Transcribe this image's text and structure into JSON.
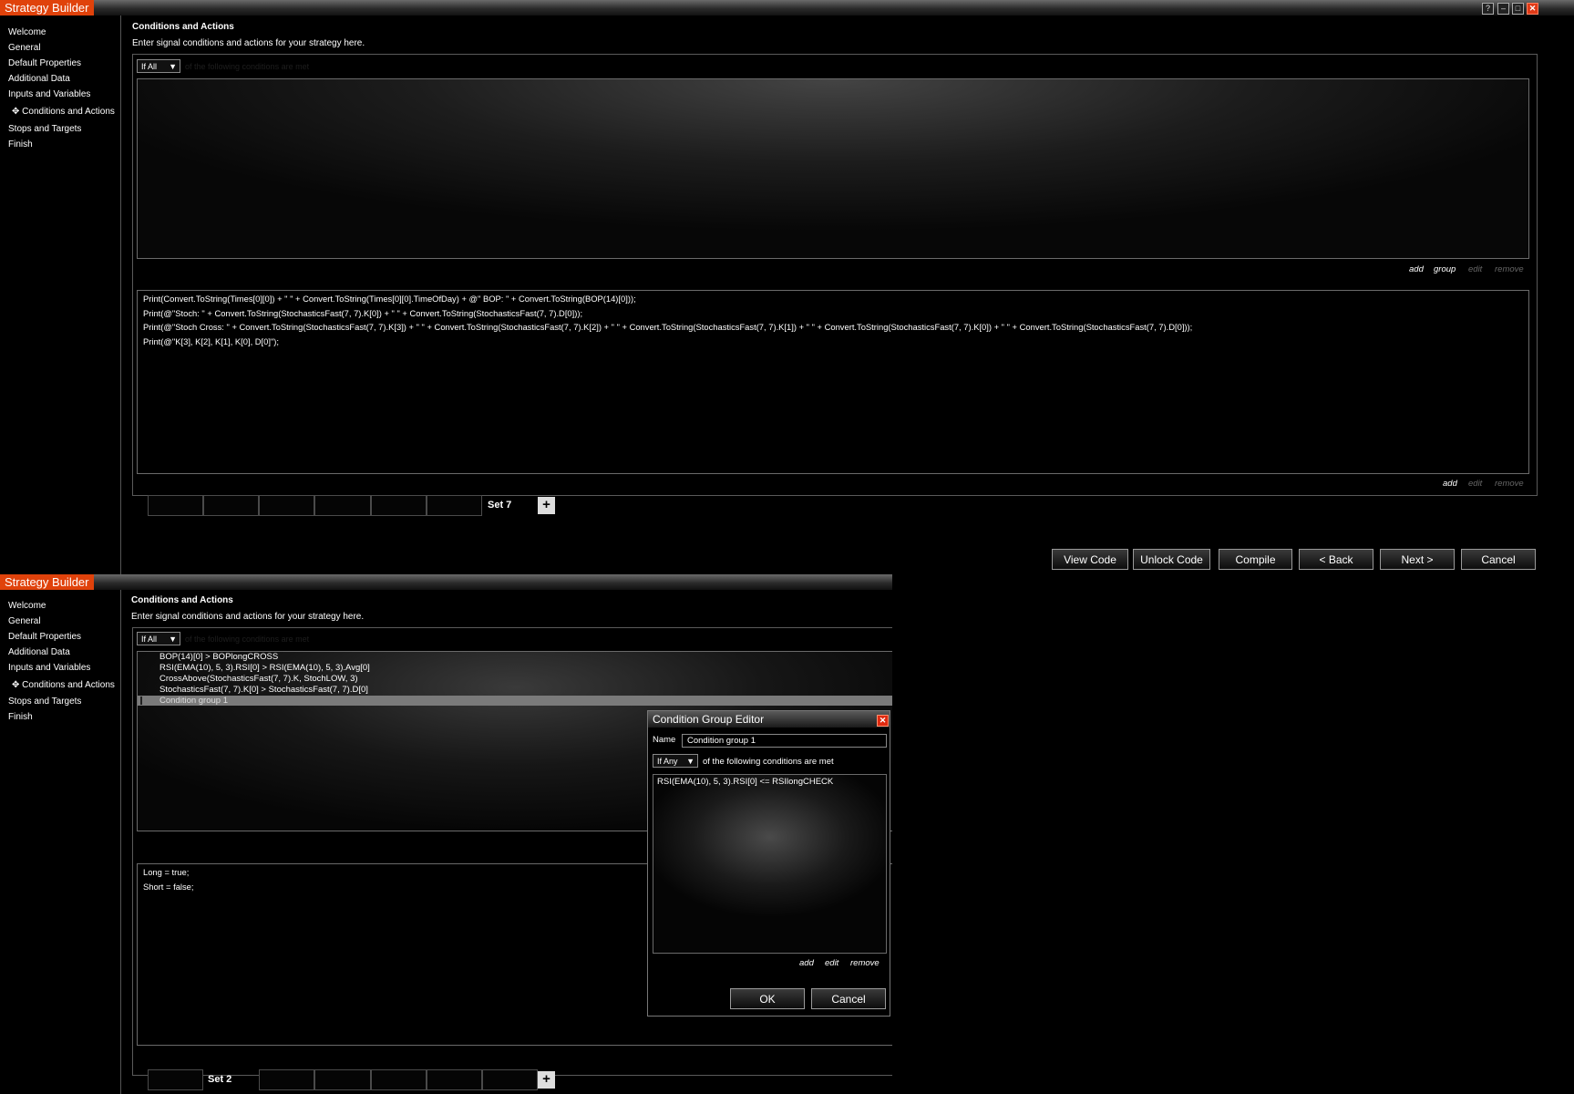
{
  "top": {
    "app_title": "Strategy Builder",
    "window_controls": [
      "?",
      "–",
      "□",
      "✕"
    ],
    "sidebar": [
      "Welcome",
      "General",
      "Default Properties",
      "Additional Data",
      "Inputs and Variables",
      "✥ Conditions and Actions",
      "Stops and Targets",
      "Finish"
    ],
    "header": "Conditions and Actions",
    "subheader": "Enter signal conditions and actions for your strategy here.",
    "match_mode": "If All",
    "match_text": "of the following conditions are met",
    "condition_links": {
      "add": "add",
      "group": "group",
      "edit": "edit",
      "remove": "remove"
    },
    "actions": [
      "Print(Convert.ToString(Times[0][0]) + \" \" + Convert.ToString(Times[0][0].TimeOfDay) + @\" BOP:  \" + Convert.ToString(BOP(14)[0]));",
      "Print(@\"Stoch: \" + Convert.ToString(StochasticsFast(7, 7).K[0]) + \" \" + Convert.ToString(StochasticsFast(7, 7).D[0]));",
      "Print(@\"Stoch Cross: \" + Convert.ToString(StochasticsFast(7, 7).K[3]) + \" \" + Convert.ToString(StochasticsFast(7, 7).K[2]) + \" \" + Convert.ToString(StochasticsFast(7, 7).K[1]) + \" \" + Convert.ToString(StochasticsFast(7, 7).K[0]) + \" \" + Convert.ToString(StochasticsFast(7, 7).D[0]));",
      "Print(@\"K[3], K[2], K[1], K[0], D[0]\");"
    ],
    "action_links": {
      "add": "add",
      "edit": "edit",
      "remove": "remove"
    },
    "active_tab": "Set 7",
    "add_tab": "+",
    "buttons": [
      "View Code",
      "Unlock Code",
      "Compile",
      "< Back",
      "Next >",
      "Cancel"
    ]
  },
  "bottom": {
    "app_title": "Strategy Builder",
    "sidebar": [
      "Welcome",
      "General",
      "Default Properties",
      "Additional Data",
      "Inputs and Variables",
      "✥ Conditions and Actions",
      "Stops and Targets",
      "Finish"
    ],
    "header": "Conditions and Actions",
    "subheader": "Enter signal conditions and actions for your strategy here.",
    "match_mode": "If All",
    "match_text": "of the following conditions are met",
    "conditions": [
      "BOP(14)[0] > BOPlongCROSS",
      "RSI(EMA(10), 5, 3).RSI[0] > RSI(EMA(10), 5, 3).Avg[0]",
      "CrossAbove(StochasticsFast(7, 7).K, StochLOW, 3)",
      "StochasticsFast(7, 7).K[0] > StochasticsFast(7, 7).D[0]"
    ],
    "selected_condition": "Condition group 1",
    "actions": [
      "Long = true;",
      "Short = false;"
    ],
    "active_tab": "Set 2",
    "add_tab": "+"
  },
  "dialog": {
    "title": "Condition Group Editor",
    "name_label": "Name",
    "name_value": "Condition group 1",
    "match_mode": "If Any",
    "match_text": "of the following conditions are met",
    "conditions": [
      "RSI(EMA(10), 5, 3).RSI[0] <= RSIlongCHECK"
    ],
    "links": {
      "add": "add",
      "edit": "edit",
      "remove": "remove"
    },
    "ok": "OK",
    "cancel": "Cancel"
  }
}
